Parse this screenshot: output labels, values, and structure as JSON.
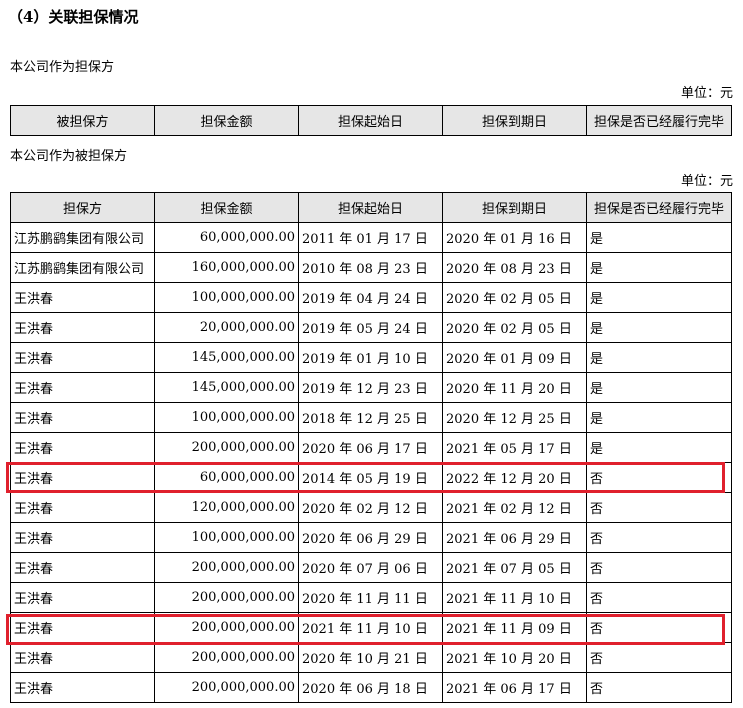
{
  "section_title": "（4）关联担保情况",
  "as_guarantor": {
    "label": "本公司作为担保方",
    "unit": "单位：元",
    "headers": [
      "被担保方",
      "担保金额",
      "担保起始日",
      "担保到期日",
      "担保是否已经履行完毕"
    ]
  },
  "as_guaranteed": {
    "label": "本公司作为被担保方",
    "unit": "单位：元",
    "headers": [
      "担保方",
      "担保金额",
      "担保起始日",
      "担保到期日",
      "担保是否已经履行完毕"
    ],
    "rows": [
      [
        "江苏鹏鹞集团有限公司",
        "60,000,000.00",
        "2011 年 01 月 17 日",
        "2020 年 01 月 16 日",
        "是"
      ],
      [
        "江苏鹏鹞集团有限公司",
        "160,000,000.00",
        "2010 年 08 月 23 日",
        "2020 年 08 月 23 日",
        "是"
      ],
      [
        "王洪春",
        "100,000,000.00",
        "2019 年 04 月 24 日",
        "2020 年 02 月 05 日",
        "是"
      ],
      [
        "王洪春",
        "20,000,000.00",
        "2019 年 05 月 24 日",
        "2020 年 02 月 05 日",
        "是"
      ],
      [
        "王洪春",
        "145,000,000.00",
        "2019 年 01 月 10 日",
        "2020 年 01 月 09 日",
        "是"
      ],
      [
        "王洪春",
        "145,000,000.00",
        "2019 年 12 月 23 日",
        "2020 年 11 月 20 日",
        "是"
      ],
      [
        "王洪春",
        "100,000,000.00",
        "2018 年 12 月 25 日",
        "2020 年 12 月 25 日",
        "是"
      ],
      [
        "王洪春",
        "200,000,000.00",
        "2020 年 06 月 17 日",
        "2021 年 05 月 17 日",
        "是"
      ],
      [
        "王洪春",
        "60,000,000.00",
        "2014 年 05 月 19 日",
        "2022 年 12 月 20 日",
        "否"
      ],
      [
        "王洪春",
        "120,000,000.00",
        "2020 年 02 月 12 日",
        "2021 年 02 月 12 日",
        "否"
      ],
      [
        "王洪春",
        "100,000,000.00",
        "2020 年 06 月 29 日",
        "2021 年 06 月 29 日",
        "否"
      ],
      [
        "王洪春",
        "200,000,000.00",
        "2020 年 07 月 06 日",
        "2021 年 07 月 05 日",
        "否"
      ],
      [
        "王洪春",
        "200,000,000.00",
        "2020 年 11 月 11 日",
        "2021 年 11 月 10 日",
        "否"
      ],
      [
        "王洪春",
        "200,000,000.00",
        "2021 年 11 月 10 日",
        "2021 年 11 月 09 日",
        "否"
      ],
      [
        "王洪春",
        "200,000,000.00",
        "2020 年 10 月 21 日",
        "2021 年 10 月 20 日",
        "否"
      ],
      [
        "王洪春",
        "200,000,000.00",
        "2020 年 06 月 18 日",
        "2021 年 06 月 17 日",
        "否"
      ]
    ]
  },
  "highlight_color": "#e0202d"
}
